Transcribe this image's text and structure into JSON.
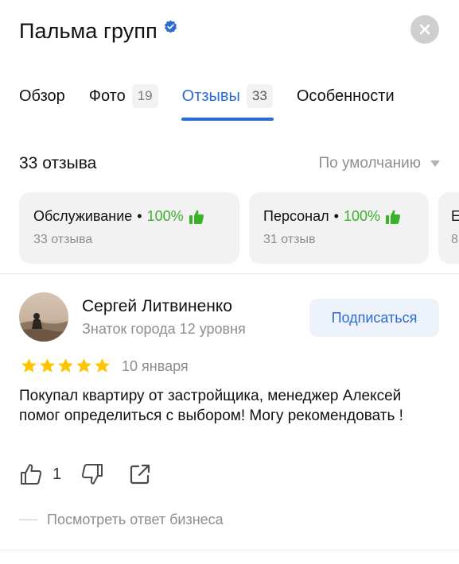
{
  "header": {
    "title": "Пальма групп",
    "verified_icon": "verified-check-icon",
    "close_icon": "close-icon"
  },
  "tabs": [
    {
      "label": "Обзор",
      "count": null,
      "active": false
    },
    {
      "label": "Фото",
      "count": "19",
      "active": false
    },
    {
      "label": "Отзывы",
      "count": "33",
      "active": true
    },
    {
      "label": "Особенности",
      "count": null,
      "active": false
    }
  ],
  "reviews_summary": {
    "count_label": "33 отзыва",
    "sort_label": "По умолчанию"
  },
  "aspects": [
    {
      "name": "Обслуживание",
      "separator": "•",
      "percent": "100%",
      "sub": "33 отзыва"
    },
    {
      "name": "Персонал",
      "separator": "•",
      "percent": "100%",
      "sub": "31 отзыв"
    },
    {
      "name": "Е",
      "separator": "",
      "percent": "",
      "sub": "8"
    }
  ],
  "review": {
    "author": "Сергей Литвиненко",
    "level": "Знаток города 12 уровня",
    "subscribe_label": "Подписаться",
    "rating": 5,
    "date": "10 января",
    "text": " Покупал квартиру от застройщика, менеджер Алексей помог определиться с выбором! Могу рекомендовать !",
    "likes": "1",
    "business_reply_label": "Посмотреть ответ бизнеса"
  },
  "colors": {
    "accent": "#2a6bd6",
    "positive": "#3bb02a",
    "star": "#ffc400",
    "muted": "#8e8e8e"
  }
}
